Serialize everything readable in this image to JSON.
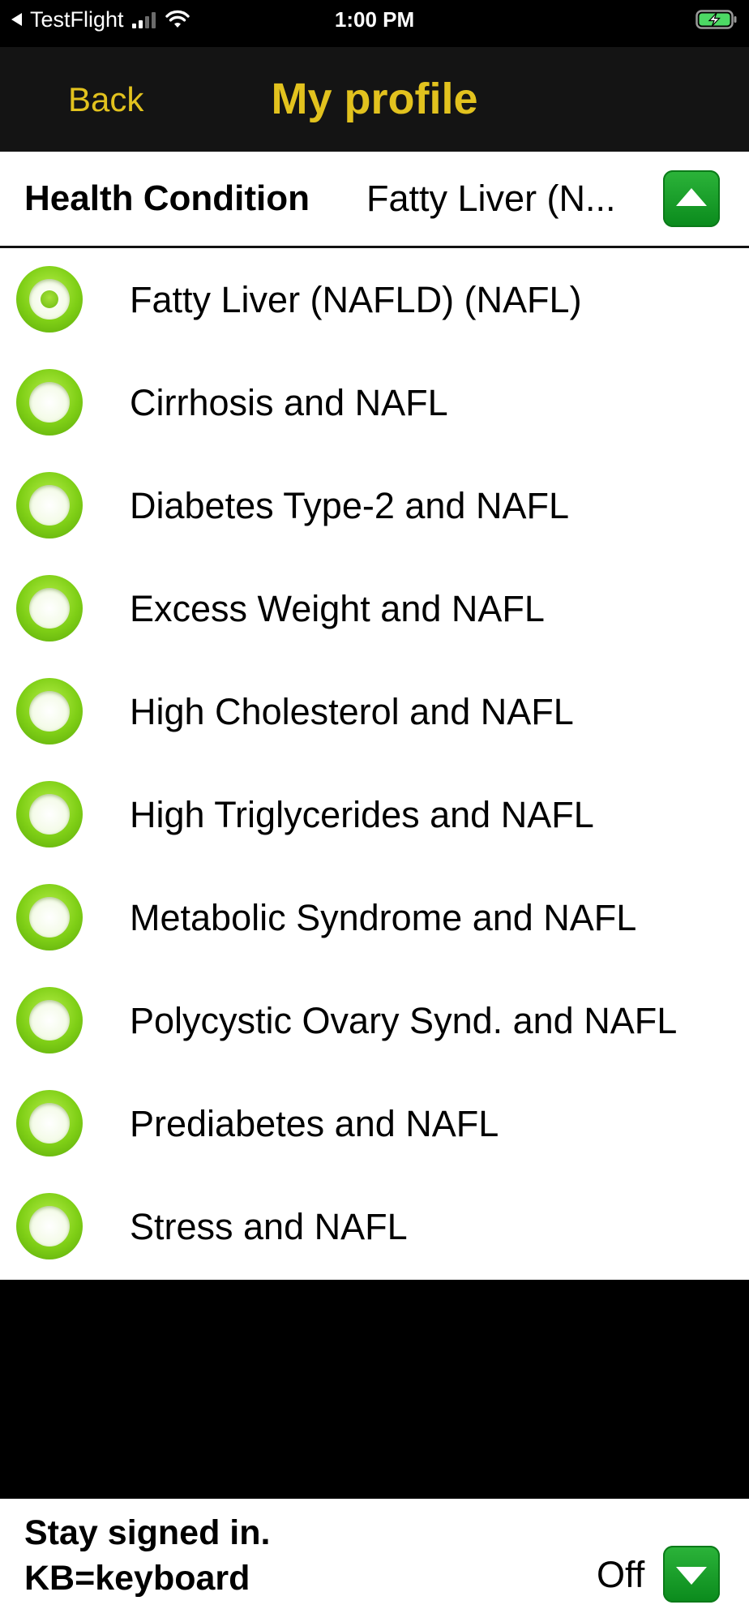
{
  "status_bar": {
    "back_app": "TestFlight",
    "time": "1:00 PM",
    "icons": [
      "back-arrow-icon",
      "signal-icon",
      "wifi-icon",
      "battery-charging-icon"
    ]
  },
  "nav": {
    "back_label": "Back",
    "title": "My profile"
  },
  "health_condition": {
    "label": "Health Condition",
    "value": "Fatty Liver (N...",
    "toggle_icon": "chevron-up-icon",
    "options": [
      {
        "label": "Fatty Liver (NAFLD) (NAFL)",
        "selected": true
      },
      {
        "label": "Cirrhosis and NAFL",
        "selected": false
      },
      {
        "label": "Diabetes Type-2 and NAFL",
        "selected": false
      },
      {
        "label": "Excess Weight and NAFL",
        "selected": false
      },
      {
        "label": "High Cholesterol and NAFL",
        "selected": false
      },
      {
        "label": "High Triglycerides and NAFL",
        "selected": false
      },
      {
        "label": "Metabolic Syndrome and NAFL",
        "selected": false
      },
      {
        "label": "Polycystic Ovary Synd. and NAFL",
        "selected": false
      },
      {
        "label": "Prediabetes and NAFL",
        "selected": false
      },
      {
        "label": "Stress and NAFL",
        "selected": false
      }
    ]
  },
  "footer": {
    "line1": "Stay signed in.",
    "line2": "KB=keyboard",
    "value": "Off",
    "toggle_icon": "chevron-down-icon"
  },
  "colors": {
    "accent_yellow": "#e2c21e",
    "button_green": "#14a02a",
    "radio_green": "#7fcf16",
    "nav_background": "#141414"
  }
}
